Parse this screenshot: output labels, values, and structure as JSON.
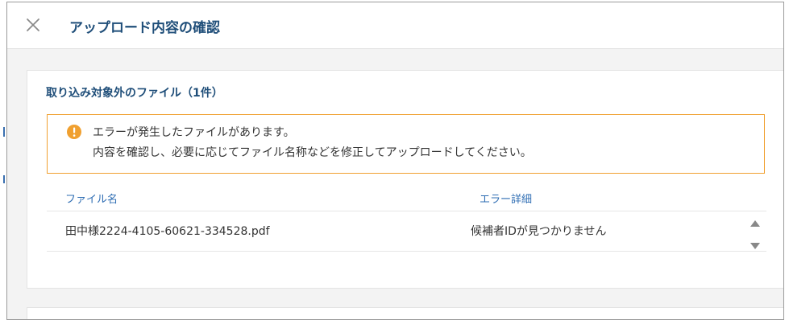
{
  "modal": {
    "title": "アップロード内容の確認",
    "close_icon": "close-icon"
  },
  "section": {
    "title": "取り込み対象外のファイル（1件）"
  },
  "alert": {
    "icon": "warning-icon",
    "line1": "エラーが発生したファイルがあります。",
    "line2": "内容を確認し、必要に応じてファイル名称などを修正してアップロードしてください。",
    "border_color": "#f0a030"
  },
  "table": {
    "columns": [
      "ファイル名",
      "エラー詳細"
    ],
    "rows": [
      [
        "田中様2224-4105-60621-334528.pdf",
        "候補者IDが見つかりません"
      ]
    ]
  },
  "colors": {
    "title": "#1f4e79",
    "header_text": "#2e6db3",
    "accent_warning": "#f0a030"
  }
}
